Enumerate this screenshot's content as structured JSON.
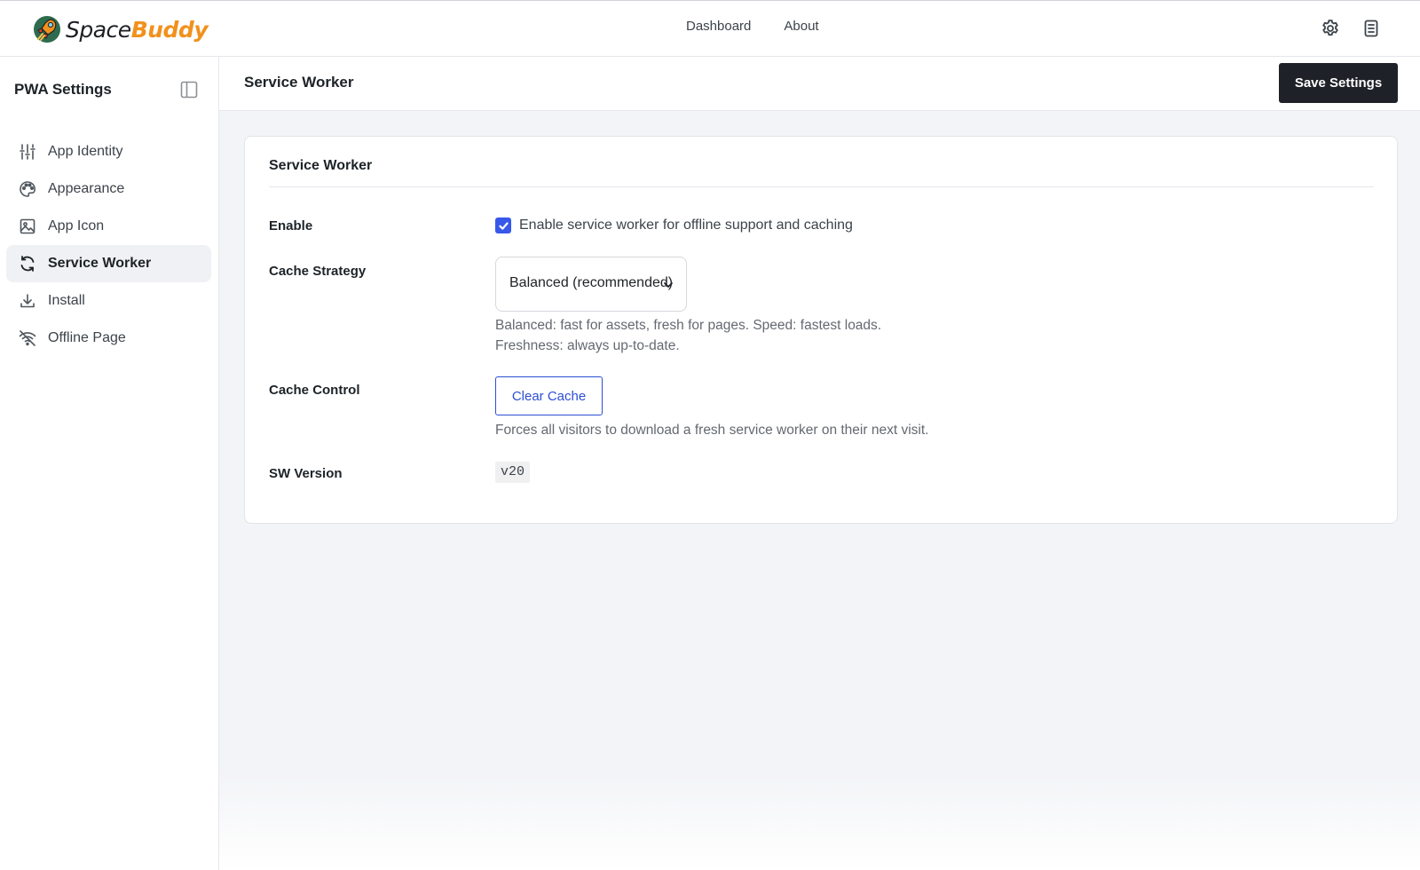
{
  "brand": {
    "name_part1": "Space",
    "name_part2": "Buddy",
    "accent": "#f1911d"
  },
  "topnav": {
    "items": [
      "Dashboard",
      "About"
    ]
  },
  "top_icons": [
    "gear-icon",
    "document-icon"
  ],
  "sidebar": {
    "title": "PWA Settings",
    "items": [
      {
        "label": "App Identity",
        "icon": "sliders-icon",
        "active": false
      },
      {
        "label": "Appearance",
        "icon": "palette-icon",
        "active": false
      },
      {
        "label": "App Icon",
        "icon": "image-icon",
        "active": false
      },
      {
        "label": "Service Worker",
        "icon": "refresh-icon",
        "active": true
      },
      {
        "label": "Install",
        "icon": "download-icon",
        "active": false
      },
      {
        "label": "Offline Page",
        "icon": "wifi-off-icon",
        "active": false
      }
    ]
  },
  "header": {
    "title": "Service Worker",
    "save_label": "Save Settings"
  },
  "card": {
    "title": "Service Worker",
    "enable": {
      "label": "Enable",
      "checkbox_label": "Enable service worker for offline support and caching",
      "checked": true
    },
    "cache_strategy": {
      "label": "Cache Strategy",
      "selected": "Balanced (recommended)",
      "help_line1": "Balanced: fast for assets, fresh for pages. Speed: fastest loads.",
      "help_line2": "Freshness: always up-to-date."
    },
    "cache_control": {
      "label": "Cache Control",
      "button_label": "Clear Cache",
      "help": "Forces all visitors to download a fresh service worker on their next visit."
    },
    "sw_version": {
      "label": "SW Version",
      "value": "v20"
    }
  },
  "colors": {
    "primary_button": "#1f2128",
    "link_blue": "#2c4fd4",
    "checkbox": "#3858e9"
  }
}
